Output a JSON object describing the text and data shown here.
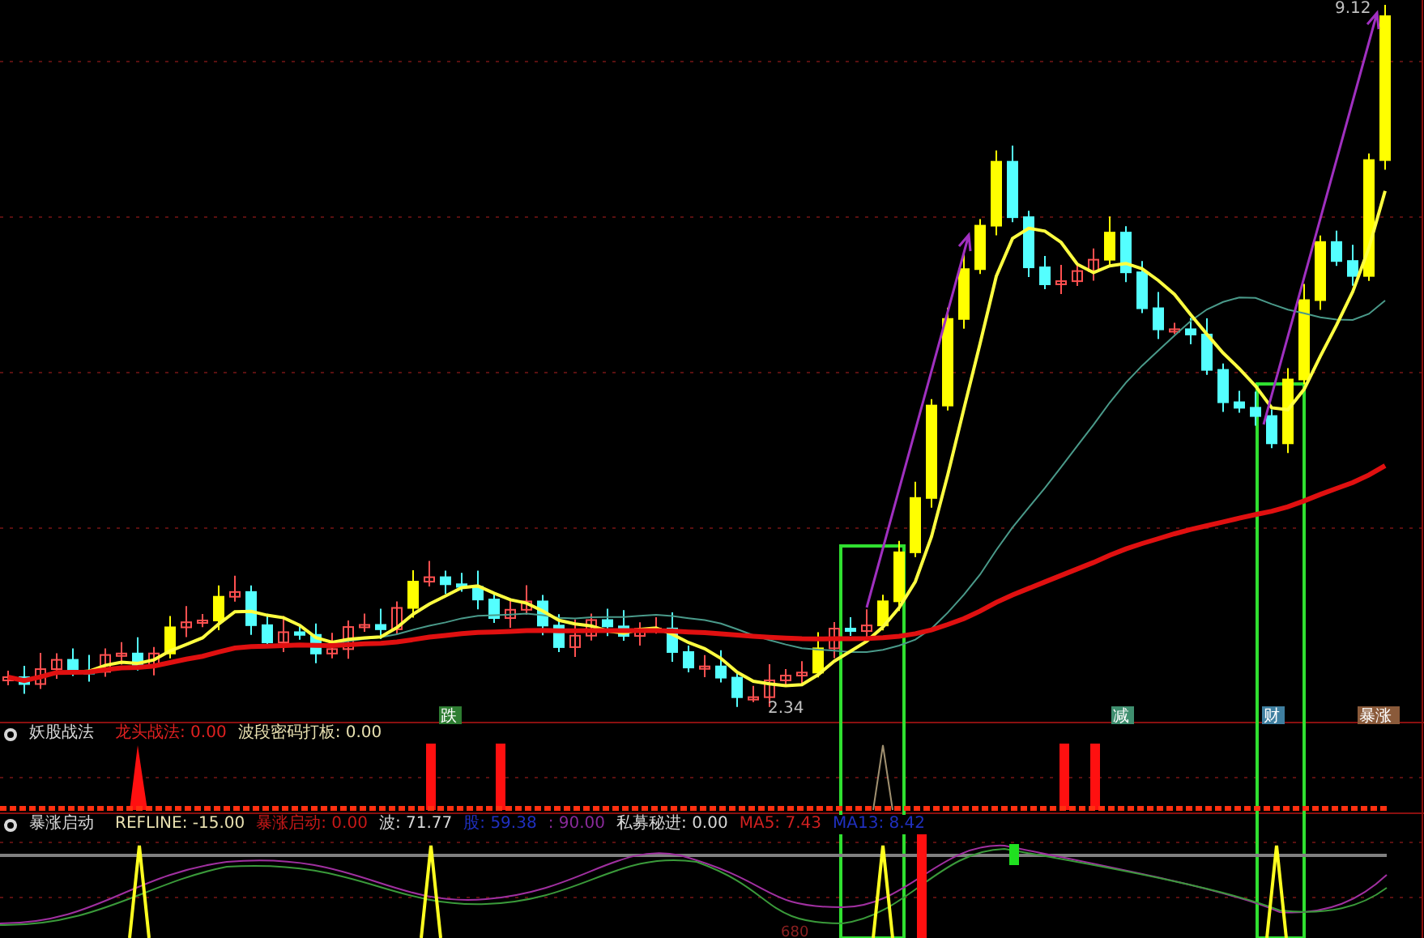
{
  "main_chart": {
    "high_label": "9.12",
    "low_label": "2.34",
    "signal_badges": [
      {
        "text": "跌",
        "color": "#2e7d32"
      },
      {
        "text": "减",
        "color": "#3f8f6f"
      },
      {
        "text": "财",
        "color": "#3f7fa0"
      },
      {
        "text": "暴涨",
        "color": "#8a5a3a"
      }
    ]
  },
  "indicator_panel": {
    "title": "妖股战法",
    "readings": [
      {
        "text": "龙头战法: 0.00",
        "color": "#e02020"
      },
      {
        "text": "波段密码打板: 0.00",
        "color": "#e8e0b0"
      }
    ]
  },
  "oscillator_panel": {
    "title": "暴涨启动",
    "readings": [
      {
        "text": "REFLINE: -15.00",
        "color": "#e8e0b0"
      },
      {
        "text": "暴涨启动: 0.00",
        "color": "#c81818"
      },
      {
        "text": "波: 71.77",
        "color": "#d8d8d8"
      },
      {
        "text": "股: 59.38",
        "color": "#2030c0"
      },
      {
        "text": ": 90.00",
        "color": "#8a2a9a"
      },
      {
        "text": "私募秘进: 0.00",
        "color": "#d8d8d8"
      },
      {
        "text": "MA5: 7.43",
        "color": "#d02020"
      },
      {
        "text": "MA13: 8.42",
        "color": "#2030c0"
      }
    ],
    "axis_label": "680"
  }
}
